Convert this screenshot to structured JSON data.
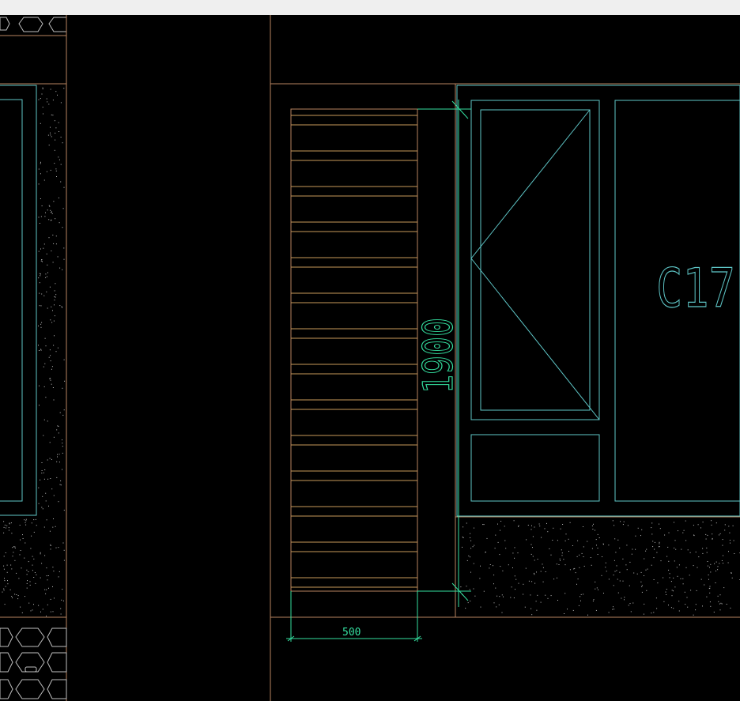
{
  "canvas": {
    "background": "#000000",
    "topbar_color": "#efefef"
  },
  "colors": {
    "orange": "#b88560",
    "cyan": "#5fc7c8",
    "green_dim": "#34e0a0",
    "white_speck": "#bfbfbf"
  },
  "drawing": {
    "window_tag": "C17",
    "dim_height_label": "1900",
    "dim_width_label": "500"
  }
}
